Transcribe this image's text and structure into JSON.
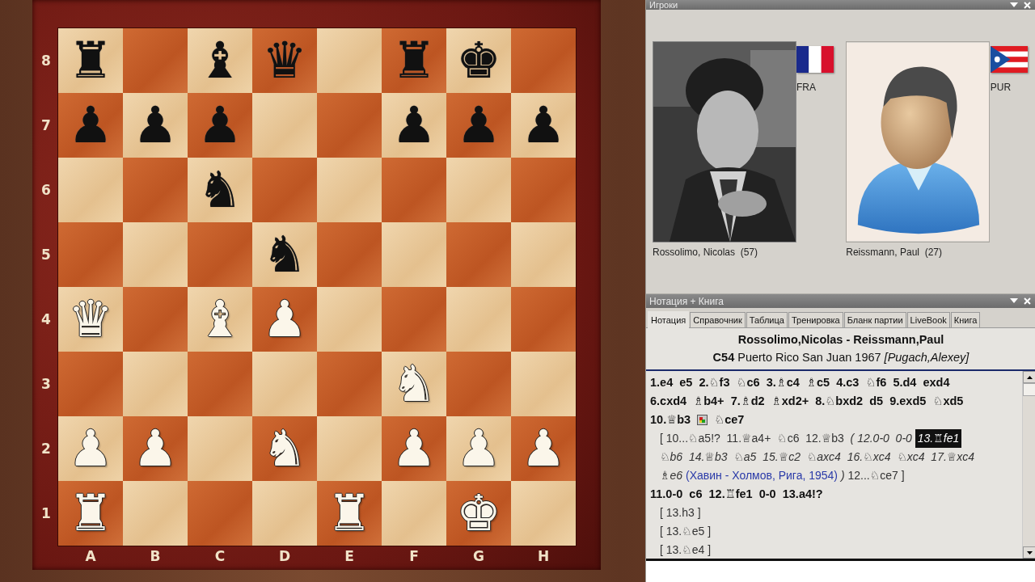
{
  "board": {
    "ranks": [
      "8",
      "7",
      "6",
      "5",
      "4",
      "3",
      "2",
      "1"
    ],
    "files": [
      "A",
      "B",
      "C",
      "D",
      "E",
      "F",
      "G",
      "H"
    ],
    "rows": [
      [
        {
          "kind": "light",
          "piece": {
            "kind": "black",
            "glyph": "♜"
          }
        },
        {
          "kind": "dark"
        },
        {
          "kind": "light",
          "piece": {
            "kind": "black",
            "glyph": "♝"
          }
        },
        {
          "kind": "dark",
          "piece": {
            "kind": "black",
            "glyph": "♛"
          }
        },
        {
          "kind": "light"
        },
        {
          "kind": "dark",
          "piece": {
            "kind": "black",
            "glyph": "♜"
          }
        },
        {
          "kind": "light",
          "piece": {
            "kind": "black",
            "glyph": "♚"
          }
        },
        {
          "kind": "dark"
        }
      ],
      [
        {
          "kind": "dark",
          "piece": {
            "kind": "black",
            "glyph": "♟"
          }
        },
        {
          "kind": "light",
          "piece": {
            "kind": "black",
            "glyph": "♟"
          }
        },
        {
          "kind": "dark",
          "piece": {
            "kind": "black",
            "glyph": "♟"
          }
        },
        {
          "kind": "light"
        },
        {
          "kind": "dark"
        },
        {
          "kind": "light",
          "piece": {
            "kind": "black",
            "glyph": "♟"
          }
        },
        {
          "kind": "dark",
          "piece": {
            "kind": "black",
            "glyph": "♟"
          }
        },
        {
          "kind": "light",
          "piece": {
            "kind": "black",
            "glyph": "♟"
          }
        }
      ],
      [
        {
          "kind": "light"
        },
        {
          "kind": "dark"
        },
        {
          "kind": "light",
          "piece": {
            "kind": "black",
            "glyph": "♞"
          }
        },
        {
          "kind": "dark"
        },
        {
          "kind": "light"
        },
        {
          "kind": "dark"
        },
        {
          "kind": "light"
        },
        {
          "kind": "dark"
        }
      ],
      [
        {
          "kind": "dark"
        },
        {
          "kind": "light"
        },
        {
          "kind": "dark"
        },
        {
          "kind": "light",
          "piece": {
            "kind": "black",
            "glyph": "♞"
          }
        },
        {
          "kind": "dark"
        },
        {
          "kind": "light"
        },
        {
          "kind": "dark"
        },
        {
          "kind": "light"
        }
      ],
      [
        {
          "kind": "light",
          "piece": {
            "kind": "white",
            "glyph": "♛"
          }
        },
        {
          "kind": "dark"
        },
        {
          "kind": "light",
          "piece": {
            "kind": "white",
            "glyph": "♝"
          }
        },
        {
          "kind": "dark",
          "piece": {
            "kind": "white",
            "glyph": "♟"
          }
        },
        {
          "kind": "light"
        },
        {
          "kind": "dark"
        },
        {
          "kind": "light"
        },
        {
          "kind": "dark"
        }
      ],
      [
        {
          "kind": "dark"
        },
        {
          "kind": "light"
        },
        {
          "kind": "dark"
        },
        {
          "kind": "light"
        },
        {
          "kind": "dark"
        },
        {
          "kind": "light",
          "piece": {
            "kind": "white",
            "glyph": "♞"
          }
        },
        {
          "kind": "dark"
        },
        {
          "kind": "light"
        }
      ],
      [
        {
          "kind": "light",
          "piece": {
            "kind": "white",
            "glyph": "♟"
          }
        },
        {
          "kind": "dark",
          "piece": {
            "kind": "white",
            "glyph": "♟"
          }
        },
        {
          "kind": "light"
        },
        {
          "kind": "dark",
          "piece": {
            "kind": "white",
            "glyph": "♞"
          }
        },
        {
          "kind": "light"
        },
        {
          "kind": "dark",
          "piece": {
            "kind": "white",
            "glyph": "♟"
          }
        },
        {
          "kind": "light",
          "piece": {
            "kind": "white",
            "glyph": "♟"
          }
        },
        {
          "kind": "dark",
          "piece": {
            "kind": "white",
            "glyph": "♟"
          }
        }
      ],
      [
        {
          "kind": "dark",
          "piece": {
            "kind": "white",
            "glyph": "♜"
          }
        },
        {
          "kind": "light"
        },
        {
          "kind": "dark"
        },
        {
          "kind": "light"
        },
        {
          "kind": "dark",
          "piece": {
            "kind": "white",
            "glyph": "♜"
          }
        },
        {
          "kind": "light"
        },
        {
          "kind": "dark",
          "piece": {
            "kind": "white",
            "glyph": "♚"
          }
        },
        {
          "kind": "light"
        }
      ]
    ]
  },
  "players_panel": {
    "title": "Игроки",
    "players": [
      {
        "name": "Rossolimo, Nicolas  (57)",
        "country": "FRA",
        "kind": "france"
      },
      {
        "name": "Reissmann, Paul  (27)",
        "country": "PUR",
        "kind": "puerto_rico"
      }
    ]
  },
  "notation_panel": {
    "title": "Нотация + Книга",
    "tabs": [
      {
        "label": "Нотация",
        "selected": true
      },
      {
        "label": "Справочник",
        "selected": false
      },
      {
        "label": "Таблица",
        "selected": false
      },
      {
        "label": "Тренировка",
        "selected": false
      },
      {
        "label": "Бланк партии",
        "selected": false
      },
      {
        "label": "LiveBook",
        "selected": false
      },
      {
        "label": "Книга",
        "selected": false
      }
    ],
    "game_title": "Rossolimo,Nicolas - Reissmann,Paul",
    "game_info": "**C54** Puerto Rico San Juan 1967 *[Pugach,Alexey]*",
    "lines": [
      {
        "kind": "main",
        "segments": [
          {
            "kind": "plain",
            "text": "1.e4  e5  2.♘f3  ♘c6  3.♗c4  ♗c5  4.c3  ♘f6  5.d4  exd4"
          }
        ]
      },
      {
        "kind": "main",
        "segments": [
          {
            "kind": "plain",
            "text": "6.cxd4  ♗b4+  7.♗d2  ♗xd2+  8.♘bxd2  d5  9.exd5  ♘xd5"
          }
        ]
      },
      {
        "kind": "main",
        "segments": [
          {
            "kind": "plain",
            "text": "10.♕b3 "
          },
          {
            "kind": "diagram"
          },
          {
            "kind": "plain",
            "text": " ♘ce7"
          }
        ]
      },
      {
        "kind": "variation",
        "segments": [
          {
            "kind": "plain",
            "text": "[ 10...♘a5!?  11.♕a4+  ♘c6  12.♕b3  "
          },
          {
            "kind": "italic",
            "text": "( 12.0-0  0-0 "
          },
          {
            "kind": "current",
            "text": "13.♖fe1"
          }
        ]
      },
      {
        "kind": "variation",
        "segments": [
          {
            "kind": "italic",
            "text": "♘b6  14.♕b3  ♘a5  15.♕c2  ♘axc4  16.♘xc4  ♘xc4  17.♕xc4"
          }
        ]
      },
      {
        "kind": "variation",
        "segments": [
          {
            "kind": "italic",
            "text": "♗e6 "
          },
          {
            "kind": "comment",
            "text": "(Хавин - Холмов, Рига, 1954)"
          },
          {
            "kind": "italic",
            "text": " ) "
          },
          {
            "kind": "plain",
            "text": "12...♘ce7 ]"
          }
        ]
      },
      {
        "kind": "main",
        "segments": [
          {
            "kind": "plain",
            "text": "11.0-0  c6  12.♖fe1  0-0  13.a4!?"
          }
        ]
      },
      {
        "kind": "variation",
        "segments": [
          {
            "kind": "plain",
            "text": "[ 13.h3 ]"
          }
        ]
      },
      {
        "kind": "variation",
        "segments": [
          {
            "kind": "plain",
            "text": "[ 13.♘e5 ]"
          }
        ]
      },
      {
        "kind": "variation",
        "segments": [
          {
            "kind": "plain",
            "text": "[ 13.♘e4 ]"
          }
        ]
      }
    ]
  }
}
